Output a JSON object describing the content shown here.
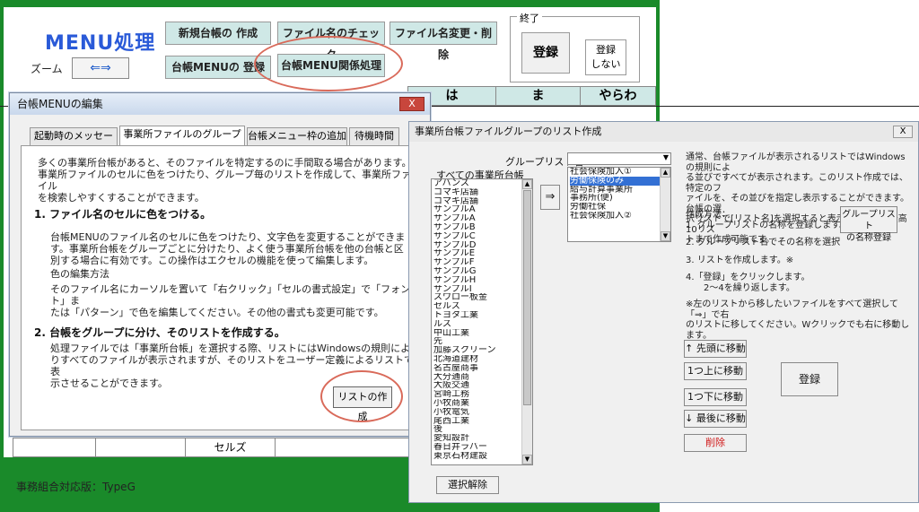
{
  "sheet": {
    "menu_title": "MENU処理",
    "zoom_label": "ズーム",
    "zoom_arrows": "⇐⇒",
    "buttons": {
      "new_ledger": "新規台帳の 作成",
      "file_check": "ファイル名のチェック",
      "file_rename": "ファイル名変更・削除",
      "ledger_menu_reg": "台帳MENUの 登録",
      "ledger_menu_rel": "台帳MENU関係処理"
    },
    "end_group_label": "終了",
    "register": "登録",
    "no_register": [
      "登録",
      "しない"
    ],
    "grid_headers": [
      "は",
      "ま",
      "やらわ"
    ],
    "bottom_cell": "セルズ",
    "footer": "事務組合対応版：TypeG"
  },
  "win1": {
    "title": "台帳MENUの編集",
    "close": "X",
    "tabs": [
      "起動時のメッセージ",
      "事業所ファイルのグループ分",
      "台帳メニュー枠の追加",
      "待機時間"
    ],
    "intro": [
      "多くの事業所台帳があると、そのファイルを特定するのに手間取る場合があります。",
      "事業所ファイルのセルに色をつけたり、グループ毎のリストを作成して、事業所ファイル",
      "を検索しやすくすることができます。"
    ],
    "h1": "1. ファイル名のセルに色をつける。",
    "p1": [
      "台帳MENUのファイル名のセルに色をつけたり、文字色を変更することができま",
      "す。事業所台帳をグループごとに分けたり、よく使う事業所台帳を他の台帳と区",
      "別する場合に有効です。この操作はエクセルの機能を使って編集します。"
    ],
    "color_method": "色の編集方法",
    "p2": [
      "そのファイル名にカーソルを置いて「右クリック」「セルの書式設定」で「フォント」ま",
      "たは「パターン」で色を編集してください。その他の書式も変更可能です。"
    ],
    "h2": "2. 台帳をグループに分け、そのリストを作成する。",
    "p3": [
      "処理ファイルでは「事業所台帳」を選択する際、リストにはWindowsの規則によ",
      "りすべてのファイルが表示されますが、そのリストをユーザー定義によるリストで表",
      "示させることができます。"
    ],
    "make_list": "リストの作成"
  },
  "win2": {
    "title": "事業所台帳ファイルグループのリスト作成",
    "close": "X",
    "group_list_label": "グループリスト名",
    "all_label": "すべての事業所台帳",
    "all_items": [
      "アバンス",
      "コマキ店舗",
      "コマキ店舗",
      "サンプルA",
      "サンプルA",
      "サンプルB",
      "サンプルC",
      "サンプルD",
      "サンプルE",
      "サンプルF",
      "サンプルG",
      "サンプルH",
      "サンプルI",
      "スワロー板金",
      "セルズ",
      "トヨタ工業",
      "ルス",
      "中山工業",
      "先",
      "加藤スクリーン",
      "北海道建材",
      "名古屋商事",
      "大分通商",
      "大阪交通",
      "宮崎工務",
      "小牧商業",
      "小牧電気",
      "尾西工業",
      "後",
      "愛知設計",
      "春日井ラバー",
      "東京石材建設"
    ],
    "move_btn": "⇒",
    "group_items": [
      "社会保険加入①",
      "労働保険のみ",
      "給与計算事業所",
      "事務所(便)",
      "労働社保",
      "社会保険加入②"
    ],
    "selected_index": 1,
    "desc": [
      "通常、台帳ファイルが表示されるリストではWindowsの規則によ",
      "る並びですべてが表示されます。このリスト作成では、特定のフ",
      "ァイルを、その並びを指定し表示することができます。台帳の選",
      "択リストで[リスト名]を選択すると表示されます。最高10リス",
      "トまで作成可能です。"
    ],
    "howto_title": "作成方法：",
    "step1": "1. グループリストの名称を登録します。",
    "step2": "2. グループリスト名でその名称を選択",
    "step3": "3. リストを作成します。※",
    "step4": "4.「登録」をクリックします。",
    "step4b": "2〜4を繰り返します。",
    "note": [
      "※左のリストから移したいファイルをすべて選択して「⇒」で右",
      "のリストに移してください。Wクリックでも右に移動します。"
    ],
    "group_reg_btn": [
      "グループリスト",
      "の名称登録"
    ],
    "move_top": "↑ 先頭に移動",
    "move_up": "1つ上に移動",
    "move_down": "1つ下に移動",
    "move_bottom": "↓ 最後に移動",
    "delete": "削除",
    "delete_color": "#d01818",
    "register": "登録",
    "clear_sel": "選択解除"
  }
}
